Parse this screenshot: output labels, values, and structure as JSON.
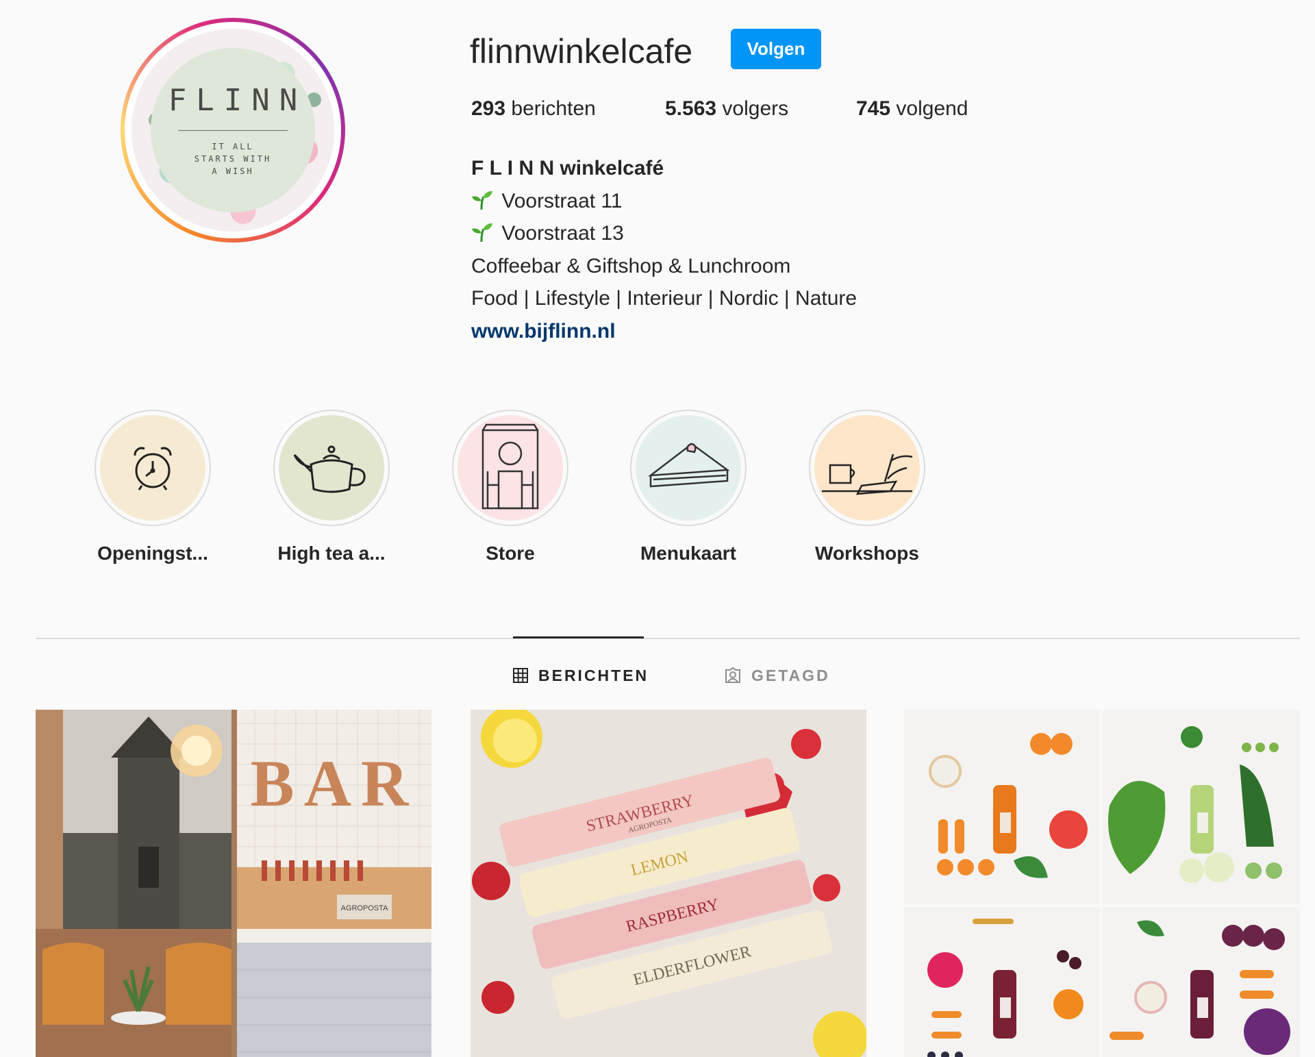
{
  "profile": {
    "username": "flinnwinkelcafe",
    "follow_label": "Volgen",
    "avatar_text": {
      "brand": "FLINN",
      "tagline": "IT ALL STARTS WITH A WISH"
    }
  },
  "stats": {
    "posts_count": "293",
    "posts_label": "berichten",
    "followers_count": "5.563",
    "followers_label": "volgers",
    "following_count": "745",
    "following_label": "volgend"
  },
  "bio": {
    "name": "F L I N N winkelcafé",
    "address_1": "Voorstraat 11",
    "address_2": "Voorstraat 13",
    "line_1": "Coffeebar & Giftshop & Lunchroom",
    "line_2": "Food | Lifestyle | Interieur | Nordic | Nature",
    "website": "www.bijflinn.nl"
  },
  "highlights": [
    {
      "label": "Openingst...",
      "icon": "alarm-clock-icon",
      "color": "#f6ebd2"
    },
    {
      "label": "High tea a...",
      "icon": "teapot-icon",
      "color": "#e2e6cf"
    },
    {
      "label": "Store",
      "icon": "storefront-icon",
      "color": "#fbe3e6"
    },
    {
      "label": "Menukaart",
      "icon": "cake-slice-icon",
      "color": "#e4f0ee"
    },
    {
      "label": "Workshops",
      "icon": "writing-desk-icon",
      "color": "#fde6ca"
    }
  ],
  "tabs": {
    "posts_label": "BERICHTEN",
    "tagged_label": "GETAGD"
  },
  "posts": {
    "bar_sign": "BAR",
    "bar_shelf_label": "AGROPOSTA",
    "ice_flavors": [
      "STRAWBERRY",
      "LEMON",
      "RASPBERRY",
      "ELDERFLOWER"
    ],
    "ice_brand": "AGROPOSTA"
  },
  "colors": {
    "accent": "#0095f6",
    "link": "#00376b",
    "text": "#262626",
    "muted": "#8e8e8e",
    "border": "#dbdbdb",
    "background": "#fafafa"
  }
}
